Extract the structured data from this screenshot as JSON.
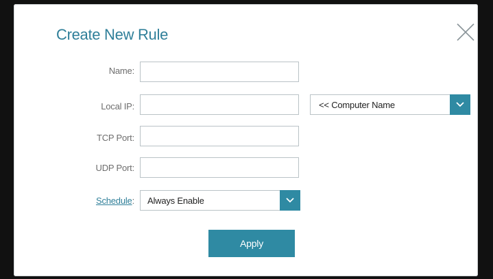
{
  "dialog": {
    "title": "Create New Rule"
  },
  "fields": {
    "name": {
      "label": "Name",
      "value": ""
    },
    "local_ip": {
      "label": "Local IP",
      "value": ""
    },
    "tcp_port": {
      "label": "TCP Port",
      "value": ""
    },
    "udp_port": {
      "label": "UDP Port",
      "value": ""
    },
    "schedule": {
      "label": "Schedule",
      "value": "Always Enable"
    }
  },
  "computer_name_select": {
    "value": "<< Computer Name"
  },
  "colon": ":",
  "buttons": {
    "apply": "Apply"
  },
  "icons": {
    "close": "close-icon",
    "dropdown": "chevron-down-icon"
  },
  "colors": {
    "accent": "#2f8aa3",
    "title": "#2f7f99"
  }
}
